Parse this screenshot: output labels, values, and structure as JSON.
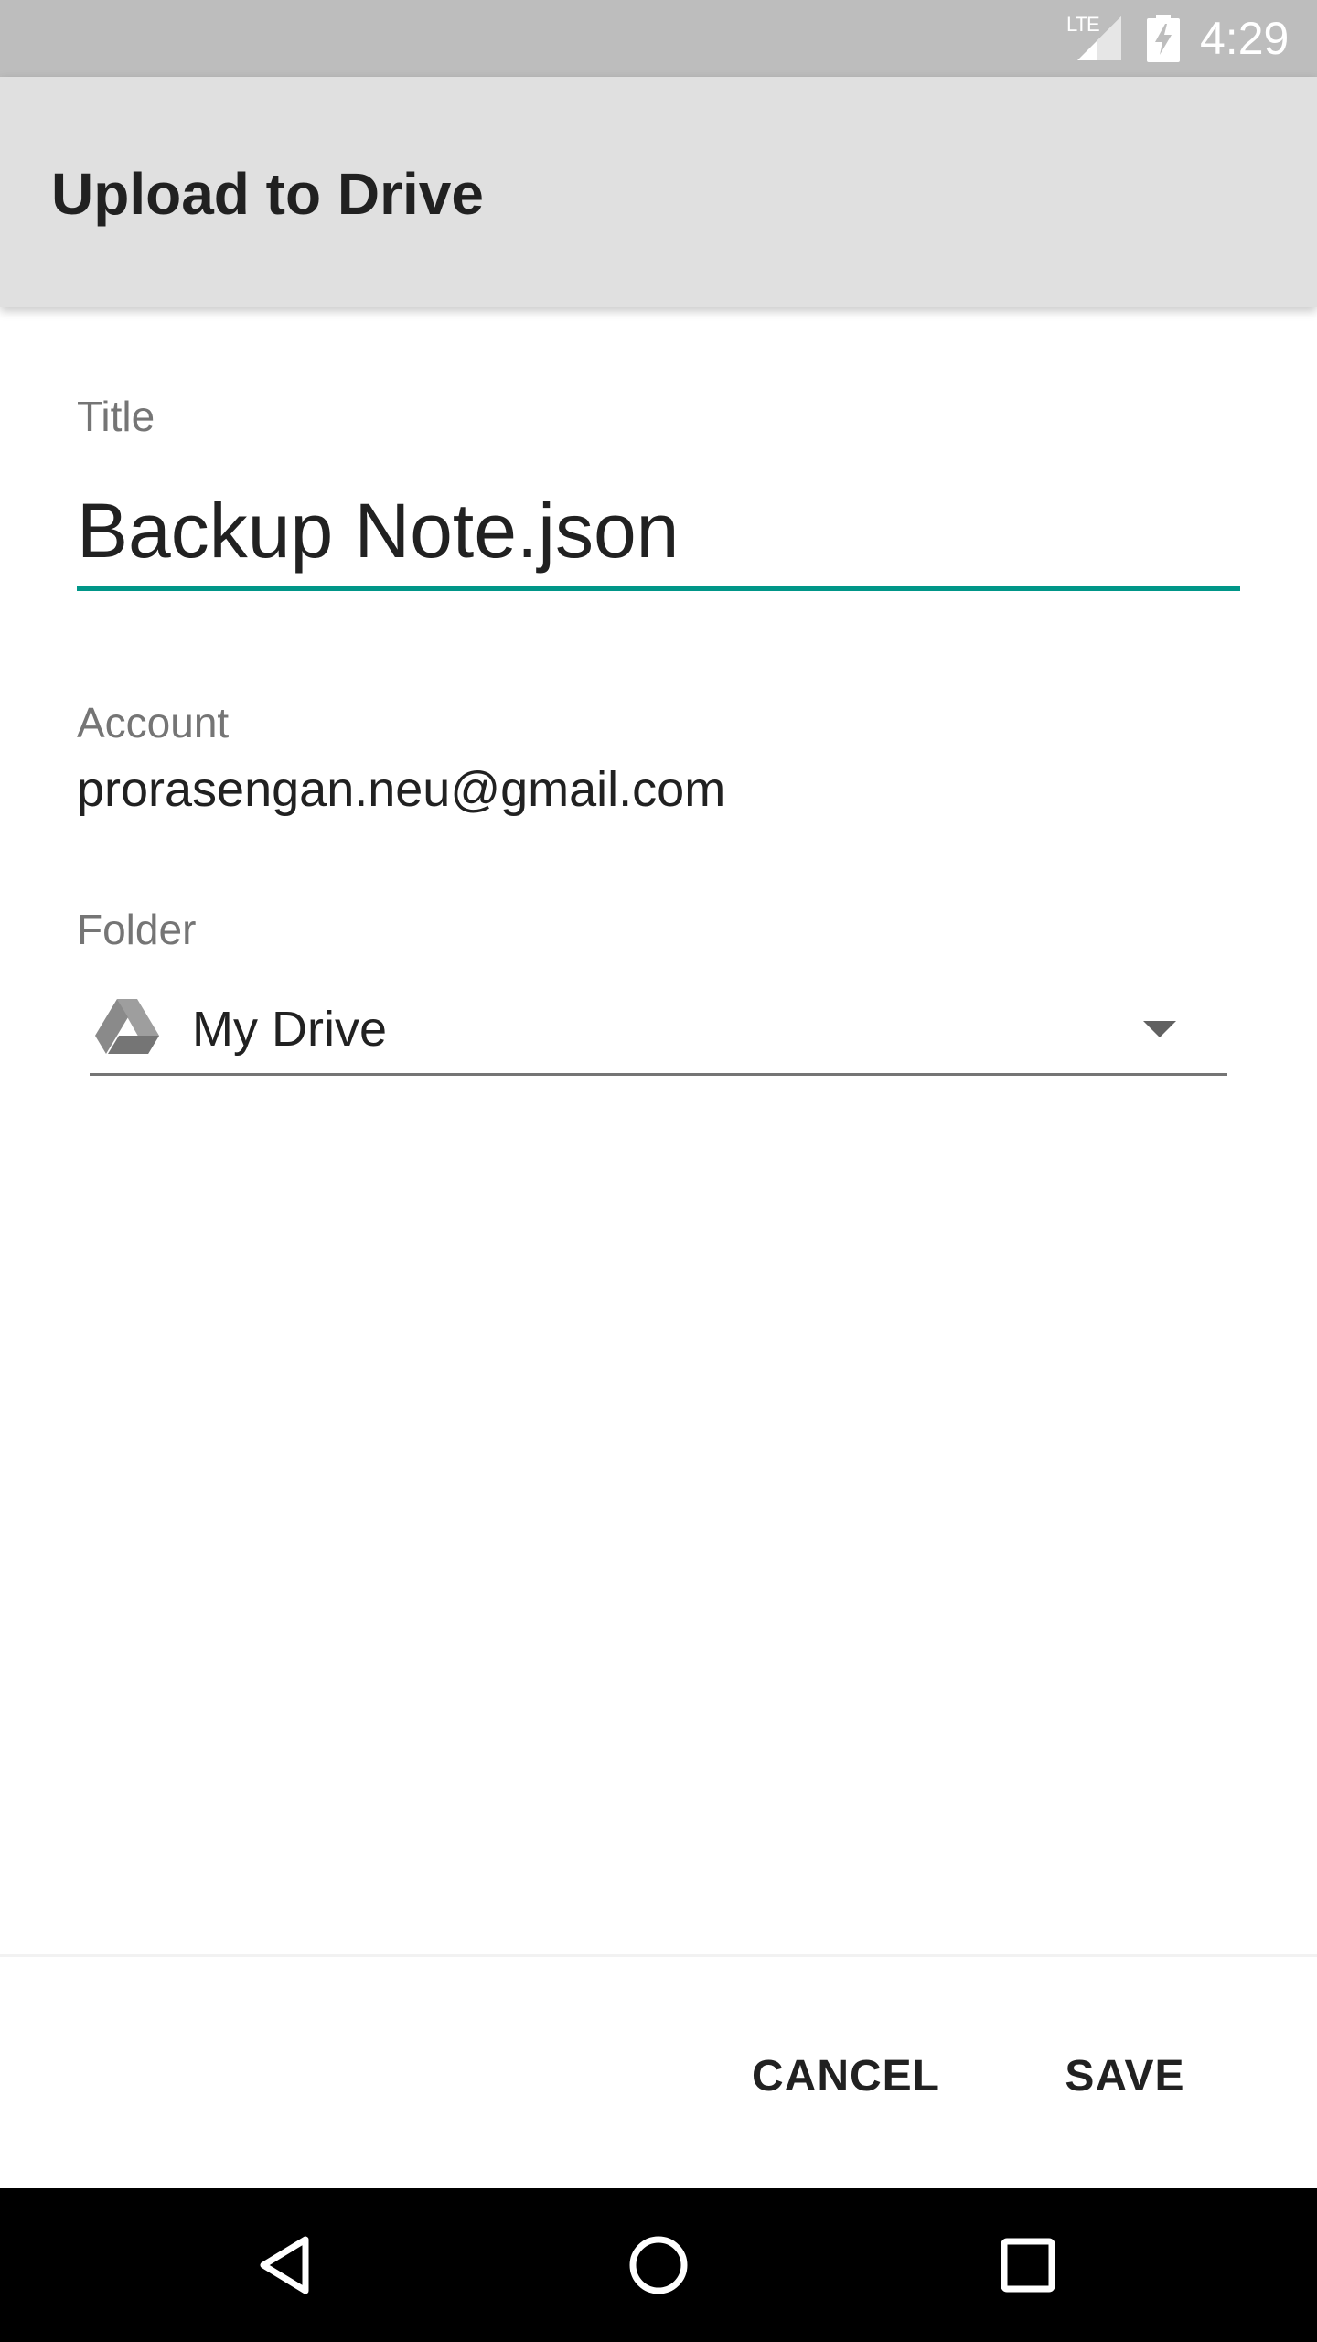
{
  "status_bar": {
    "network": "LTE",
    "time": "4:29"
  },
  "app_bar": {
    "title": "Upload to Drive"
  },
  "form": {
    "title_label": "Title",
    "title_value": "Backup Note.json",
    "account_label": "Account",
    "account_value": "prorasengan.neu@gmail.com",
    "folder_label": "Folder",
    "folder_value": "My Drive"
  },
  "actions": {
    "cancel_label": "CANCEL",
    "save_label": "SAVE"
  },
  "icons": {
    "lte": "lte-signal-icon",
    "battery": "battery-charging-icon",
    "drive": "google-drive-icon",
    "dropdown": "chevron-down-icon",
    "back": "back-triangle-icon",
    "home": "home-circle-icon",
    "recents": "recents-square-icon"
  },
  "colors": {
    "accent": "#009688",
    "app_bar": "#e0e0e0",
    "status_bar": "#bdbdbd"
  }
}
